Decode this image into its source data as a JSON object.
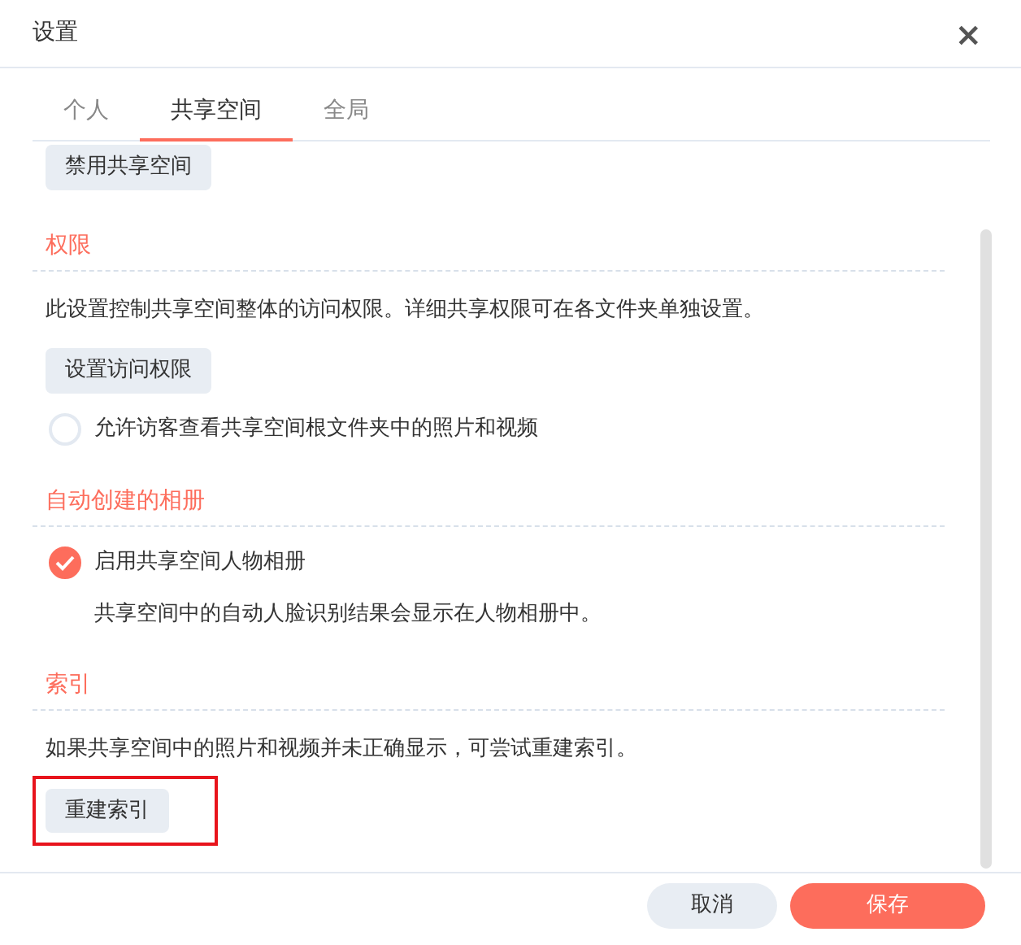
{
  "window": {
    "title": "设置",
    "close": "×"
  },
  "tabs": [
    {
      "label": "个人",
      "selected": false
    },
    {
      "label": "共享空间",
      "selected": true
    },
    {
      "label": "全局",
      "selected": false
    }
  ],
  "top_button": {
    "label": "禁用共享空间"
  },
  "sections": [
    {
      "title": "权限",
      "items": [
        {
          "kind": "text",
          "text": "此设置控制共享空间整体的访问权限。详细共享权限可在各文件夹单独设置。"
        },
        {
          "kind": "button",
          "label": "设置访问权限",
          "highlighted": false
        },
        {
          "kind": "checkbox",
          "label": "允许访客查看共享空间根文件夹中的照片和视频",
          "checked": false
        }
      ]
    },
    {
      "title": "自动创建的相册",
      "items": [
        {
          "kind": "checkbox",
          "label": "启用共享空间人物相册",
          "checked": true
        },
        {
          "kind": "note",
          "text": "共享空间中的自动人脸识别结果会显示在人物相册中。"
        }
      ]
    },
    {
      "title": "索引",
      "items": [
        {
          "kind": "text",
          "text": "如果共享空间中的照片和视频并未正确显示，可尝试重建索引。"
        },
        {
          "kind": "button",
          "label": "重建索引",
          "highlighted": true
        }
      ]
    }
  ],
  "footer": {
    "cancel": "取消",
    "save": "保存"
  }
}
